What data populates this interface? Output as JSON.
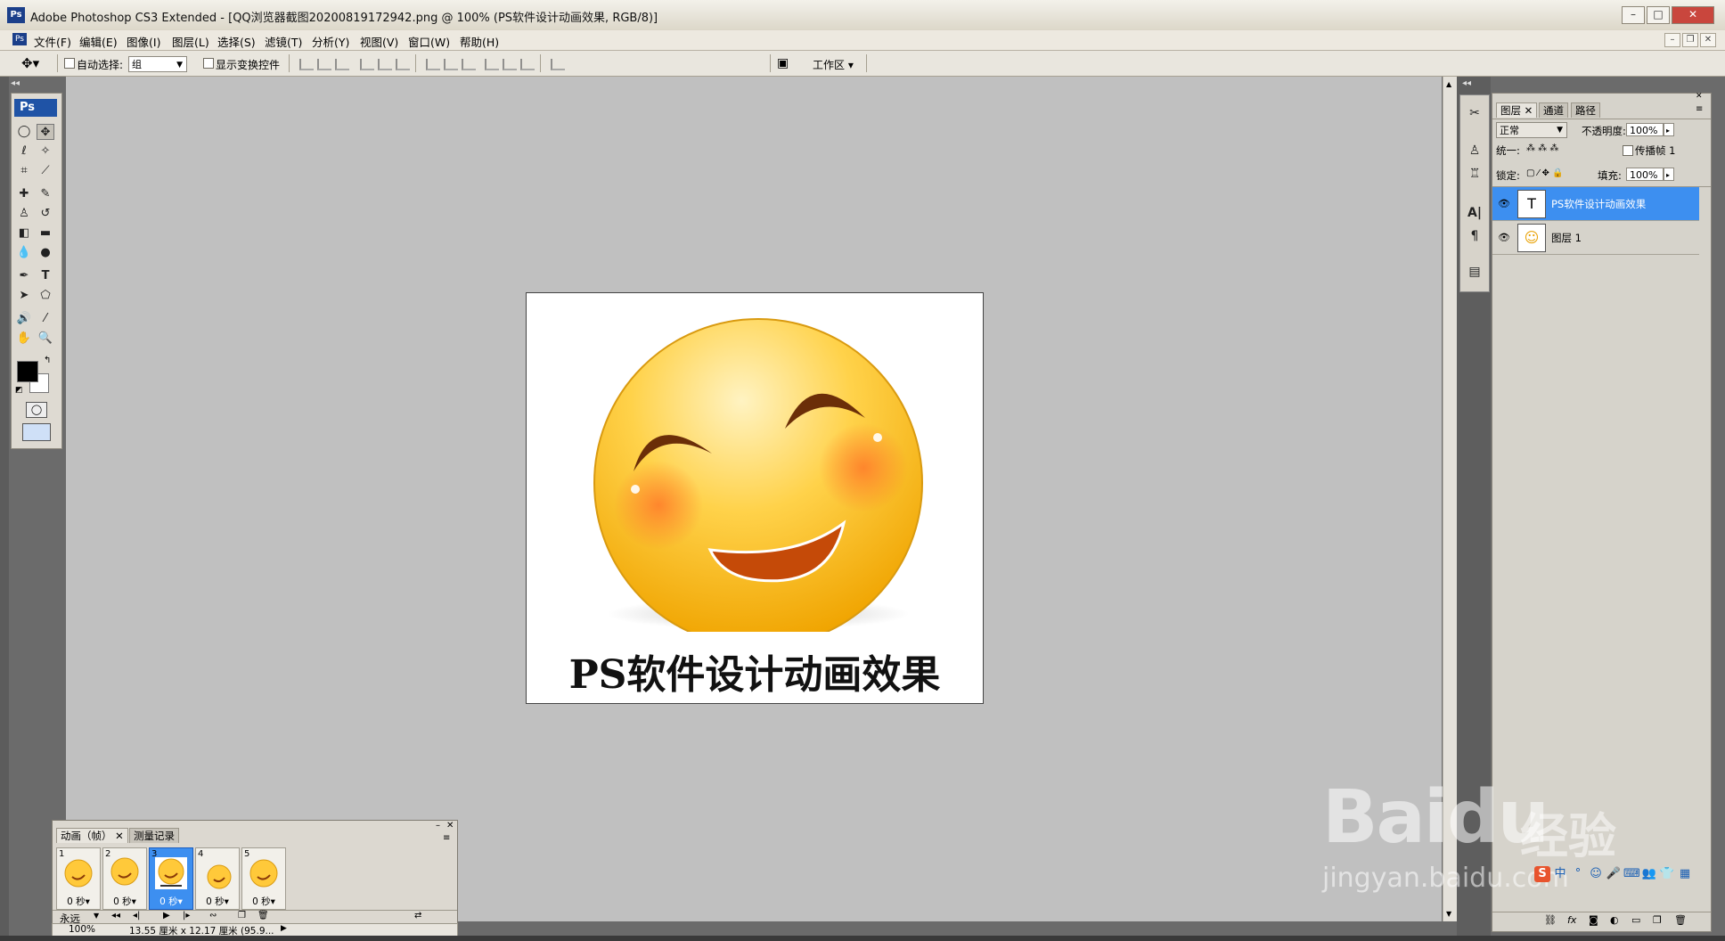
{
  "window": {
    "title": "Adobe Photoshop CS3 Extended - [QQ浏览器截图20200819172942.png @ 100% (PS软件设计动画效果, RGB/8)]",
    "app_badge": "Ps"
  },
  "menu": {
    "items": [
      "文件(F)",
      "编辑(E)",
      "图像(I)",
      "图层(L)",
      "选择(S)",
      "滤镜(T)",
      "分析(Y)",
      "视图(V)",
      "窗口(W)",
      "帮助(H)"
    ]
  },
  "options": {
    "auto_select_label": "自动选择:",
    "auto_select_value": "组",
    "show_transform_label": "显示变换控件",
    "workspace_label": "工作区 ▾"
  },
  "toolbox": {
    "logo": "Ps"
  },
  "document": {
    "caption": "PS软件设计动画效果"
  },
  "layers_panel": {
    "tabs": [
      "图层",
      "通道",
      "路径"
    ],
    "blend_mode": "正常",
    "opacity_label": "不透明度:",
    "opacity_value": "100%",
    "unify_label": "统一:",
    "propagate_label": "传播帧 1",
    "lock_label": "锁定:",
    "fill_label": "填充:",
    "fill_value": "100%",
    "layers": [
      {
        "name": "PS软件设计动画效果",
        "thumb": "T",
        "selected": true
      },
      {
        "name": "图层 1",
        "thumb": "☺",
        "selected": false
      }
    ]
  },
  "animation_panel": {
    "tabs": [
      "动画（帧）",
      "测量记录"
    ],
    "frames": [
      {
        "num": "1",
        "delay": "0 秒▾",
        "selected": false
      },
      {
        "num": "2",
        "delay": "0 秒▾",
        "selected": false
      },
      {
        "num": "3",
        "delay": "0 秒▾",
        "selected": true
      },
      {
        "num": "4",
        "delay": "0 秒▾",
        "selected": false
      },
      {
        "num": "5",
        "delay": "0 秒▾",
        "selected": false
      }
    ],
    "loop_label": "永远"
  },
  "status": {
    "zoom": "100%",
    "doc_size": "13.55 厘米 x 12.17 厘米 (95.9..."
  },
  "watermark": {
    "brand": "Baidu",
    "suffix": "经验",
    "url": "jingyan.baidu.com"
  }
}
